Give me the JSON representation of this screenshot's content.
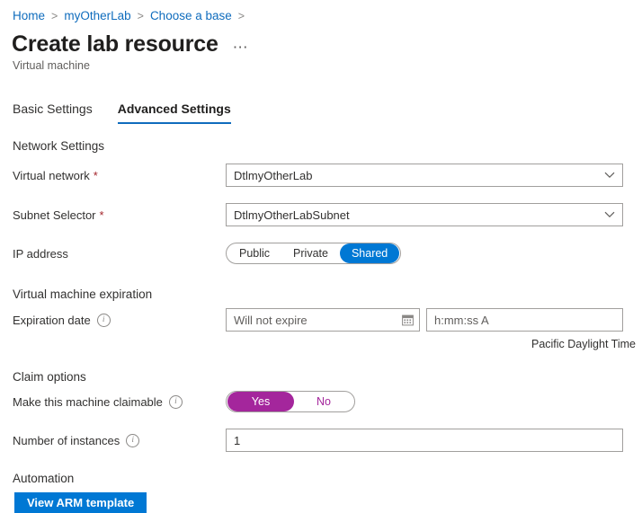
{
  "breadcrumb": {
    "items": [
      {
        "label": "Home"
      },
      {
        "label": "myOtherLab"
      },
      {
        "label": "Choose a base"
      }
    ],
    "separator": ">"
  },
  "header": {
    "title": "Create lab resource",
    "subtitle": "Virtual machine",
    "more_menu": "⋯"
  },
  "tabs": [
    {
      "label": "Basic Settings",
      "active": false
    },
    {
      "label": "Advanced Settings",
      "active": true
    }
  ],
  "sections": {
    "network": {
      "heading": "Network Settings",
      "virtual_network": {
        "label": "Virtual network",
        "required_marker": "*",
        "value": "DtlmyOtherLab"
      },
      "subnet_selector": {
        "label": "Subnet Selector",
        "required_marker": "*",
        "value": "DtlmyOtherLabSubnet"
      },
      "ip_address": {
        "label": "IP address",
        "options": [
          "Public",
          "Private",
          "Shared"
        ],
        "selected": "Shared"
      }
    },
    "expiration": {
      "heading": "Virtual machine expiration",
      "expiration_date": {
        "label": "Expiration date",
        "date_placeholder": "Will not expire",
        "date_value": "",
        "time_placeholder": "h:mm:ss A",
        "time_value": "",
        "timezone_note": "Pacific Daylight Time"
      }
    },
    "claim": {
      "heading": "Claim options",
      "claimable": {
        "label": "Make this machine claimable",
        "options": [
          "Yes",
          "No"
        ],
        "selected": "Yes"
      },
      "instances": {
        "label": "Number of instances",
        "value": "1"
      }
    },
    "automation": {
      "heading": "Automation",
      "view_arm_template_label": "View ARM template"
    }
  },
  "colors": {
    "accent_blue": "#0078d4",
    "link_blue": "#0f6cbd",
    "purple": "#a4269c",
    "required_red": "#a4262c"
  }
}
